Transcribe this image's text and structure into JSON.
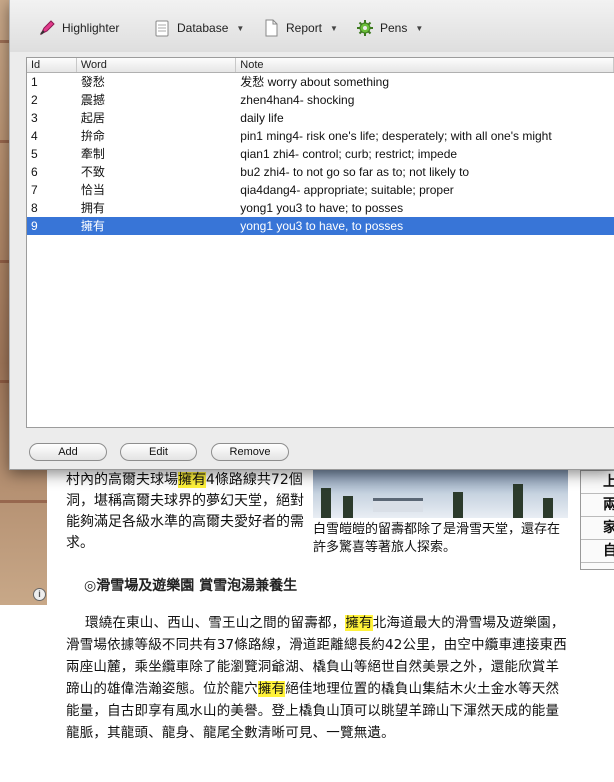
{
  "toolbar": {
    "highlighter": "Highlighter",
    "database": "Database",
    "report": "Report",
    "pens": "Pens"
  },
  "table": {
    "headers": [
      "Id",
      "Word",
      "Note"
    ],
    "rows": [
      {
        "id": "1",
        "word": "發愁",
        "note": "发愁 worry about something"
      },
      {
        "id": "2",
        "word": "震撼",
        "note": "zhen4han4- shocking"
      },
      {
        "id": "3",
        "word": "起居",
        "note": "daily life"
      },
      {
        "id": "4",
        "word": "拚命",
        "note": "pin1 ming4- risk one's life; desperately; with all one's might"
      },
      {
        "id": "5",
        "word": "牽制",
        "note": "qian1 zhi4- control; curb; restrict; impede"
      },
      {
        "id": "6",
        "word": "不致",
        "note": "bu2 zhi4- to not go so far as to; not likely to"
      },
      {
        "id": "7",
        "word": "恰当",
        "note": "qia4dang4- appropriate; suitable; proper"
      },
      {
        "id": "8",
        "word": "拥有",
        "note": "yong1 you3 to have; to posses"
      },
      {
        "id": "9",
        "word": "擁有",
        "note": "yong1 you3 to have, to posses"
      }
    ],
    "selected_row": 9
  },
  "buttons": {
    "add": "Add",
    "edit": "Edit",
    "remove": "Remove"
  },
  "webpage": {
    "para1_a": "村內的高爾夫球場",
    "para1_hl": "擁有",
    "para1_b": "4條路線共72個洞，堪稱高爾夫球界的夢幻天堂，絕對能夠滿足各級水準的高爾夫愛好者的需求。",
    "caption": "白雪皚皚的留壽都除了是滑雪天堂，還存在許多驚喜等著旅人探索。",
    "sidebox": [
      "上",
      "兩",
      "家",
      "自"
    ],
    "heading": "◎滑雪場及遊樂園 賞雪泡湯兼養生",
    "para2_a": "環繞在東山、西山、雪王山之間的留壽都，",
    "para2_hl1": "擁有",
    "para2_b": "北海道最大的滑雪場及遊樂園，滑雪場依據等級不同共有37條路線，滑道距離總長約42公里，由空中纜車連接東西兩座山麓，乘坐纜車除了能瀏覽洞爺湖、橇負山等絕世自然美景之外，還能欣賞羊蹄山的雄偉浩瀚姿態。位於龍穴",
    "para2_hl2": "擁有",
    "para2_c": "絕佳地理位置的橇負山集結木火土金水等天然能量，自古即享有風水山的美譽。登上橇負山頂可以眺望羊蹄山下渾然天成的能量龍脈，其龍頭、龍身、龍尾全數清晰可見、一覽無遺。"
  },
  "colors": {
    "selection": "#3875d7",
    "highlight": "#fff23a"
  }
}
